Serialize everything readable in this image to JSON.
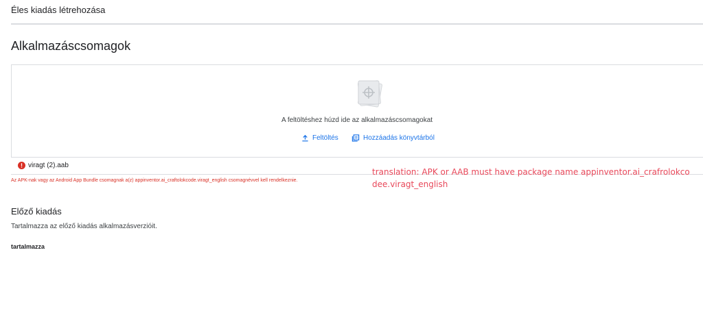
{
  "header": {
    "title": "Éles kiadás létrehozása"
  },
  "app_bundles": {
    "title": "Alkalmazáscsomagok",
    "drop_text": "A feltöltéshez húzd ide az alkalmazáscsomagokat",
    "upload_label": "Feltöltés",
    "library_label": "Hozzáadás könyvtárból",
    "file_name": "viragt (2).aab",
    "error_message": "Az APK-nak vagy az Android App Bundle csomagnak a(z) appinventor.ai_craftolokcode.viragt_english csomagnévvel kell rendelkeznie."
  },
  "annotation": "translation: APK or AAB must have package name appinventor.ai_crafrolokcodee.viragt_english",
  "previous_release": {
    "title": "Előző kiadás",
    "description": "Tartalmazza az előző kiadás alkalmazásverzióit.",
    "contains_label": "tartalmazza"
  },
  "colors": {
    "accent": "#1a73e8",
    "error": "#d93025",
    "annotation": "#e8485a",
    "border": "#dadce0"
  },
  "icons": {
    "drop": "app-bundle-stack-icon",
    "upload": "upload-icon",
    "library": "library-icon",
    "error": "error-icon"
  }
}
